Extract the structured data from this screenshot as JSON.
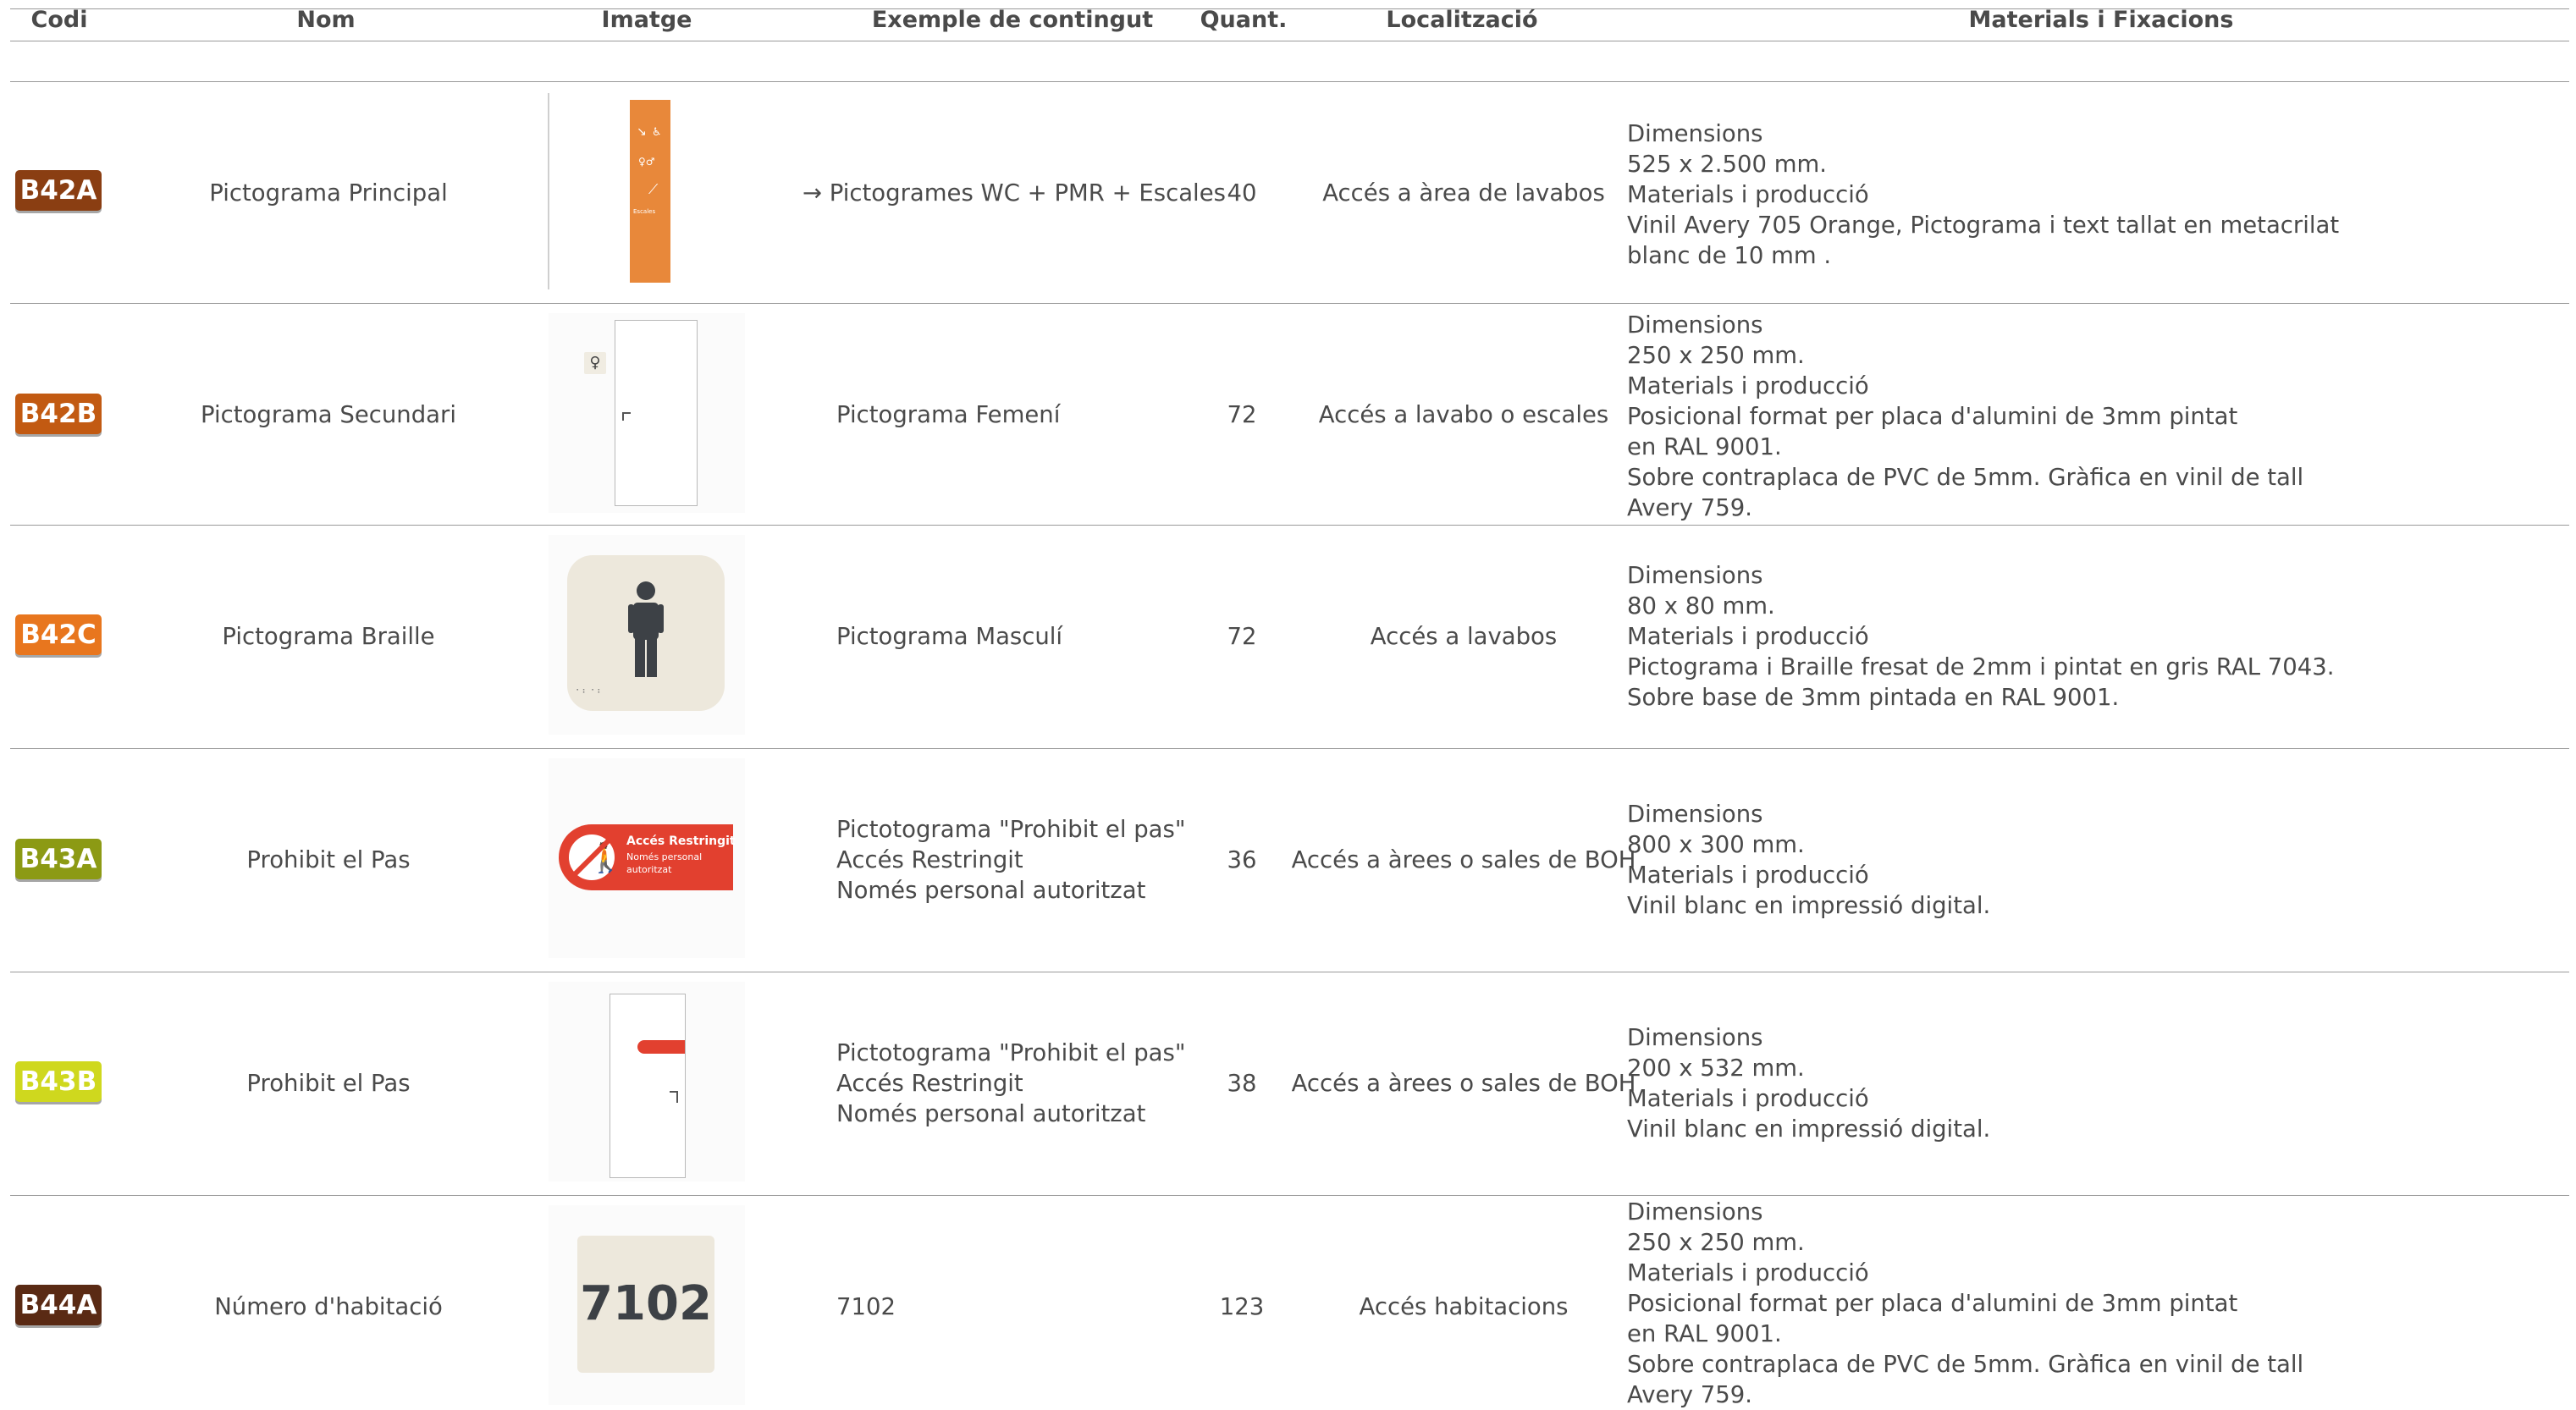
{
  "headers": {
    "codi": "Codi",
    "nom": "Nom",
    "imatge": "Imatge",
    "exemple": "Exemple de contingut",
    "quant": "Quant.",
    "localitzacio": "Localització",
    "materials": "Materials i Fixacions"
  },
  "rows": [
    {
      "code": "B42A",
      "code_color": "#8a3e12",
      "name": "Pictograma Principal",
      "content": [
        "→  Pictogrames WC + PMR + Escales"
      ],
      "qty": "40",
      "location": "Accés a àrea de lavabos",
      "materials": [
        "Dimensions",
        "525 x 2.500 mm.",
        "Materials i producció",
        "Vinil Avery 705 Orange, Pictograma i text tallat en metacrilat",
        "blanc de 10 mm ."
      ],
      "image": {
        "type": "orange-totem",
        "label": "Escales"
      }
    },
    {
      "code": "B42B",
      "code_color": "#c25a12",
      "name": "Pictograma Secundari",
      "content": [
        "Pictograma Femení"
      ],
      "qty": "72",
      "location": "Accés a lavabo o escales",
      "materials": [
        "Dimensions",
        "250 x 250 mm.",
        "Materials i producció",
        "Posicional format per placa d'alumini de 3mm pintat",
        "en RAL 9001.",
        "Sobre contraplaca de PVC de 5mm. Gràfica en vinil de tall",
        "Avery 759."
      ],
      "image": {
        "type": "door-female"
      }
    },
    {
      "code": "B42C",
      "code_color": "#e8761e",
      "name": "Pictograma Braille",
      "content": [
        "Pictograma Masculí"
      ],
      "qty": "72",
      "location": "Accés a lavabos",
      "materials": [
        "Dimensions",
        "80 x 80 mm.",
        "Materials i producció",
        "Pictograma i Braille fresat de 2mm i pintat en gris RAL 7043.",
        "Sobre base de 3mm pintada en RAL 9001."
      ],
      "image": {
        "type": "braille-male"
      }
    },
    {
      "code": "B43A",
      "code_color": "#8c9a14",
      "name": "Prohibit el Pas",
      "content": [
        "Pictotograma \"Prohibit el pas\"",
        "Accés Restringit",
        "Només personal autoritzat"
      ],
      "qty": "36",
      "location": "Accés a àrees o sales de BOH",
      "materials": [
        "Dimensions",
        "800 x 300 mm.",
        "Materials i producció",
        "Vinil blanc en impressió digital."
      ],
      "image": {
        "type": "restricted-sign",
        "title": "Accés Restringit",
        "line1": "Només personal",
        "line2": "autoritzat"
      }
    },
    {
      "code": "B43B",
      "code_color": "#cfd81e",
      "name": "Prohibit el Pas",
      "content": [
        "Pictotograma \"Prohibit el pas\"",
        "Accés Restringit",
        "Només personal autoritzat"
      ],
      "qty": "38",
      "location": "Accés a àrees o sales de BOH",
      "materials": [
        "Dimensions",
        "200 x 532 mm.",
        "Materials i producció",
        "Vinil blanc en impressió digital."
      ],
      "image": {
        "type": "door-restricted"
      }
    },
    {
      "code": "B44A",
      "code_color": "#5a2a14",
      "name": "Número d'habitació",
      "content": [
        "7102"
      ],
      "qty": "123",
      "location": "Accés habitacions",
      "materials": [
        "Dimensions",
        "250 x 250 mm.",
        "Materials i producció",
        "Posicional format per placa d'alumini de 3mm pintat",
        "en RAL 9001.",
        "Sobre contraplaca de PVC de 5mm. Gràfica en vinil de tall",
        "Avery 759."
      ],
      "image": {
        "type": "room-number",
        "number": "7102"
      }
    }
  ]
}
